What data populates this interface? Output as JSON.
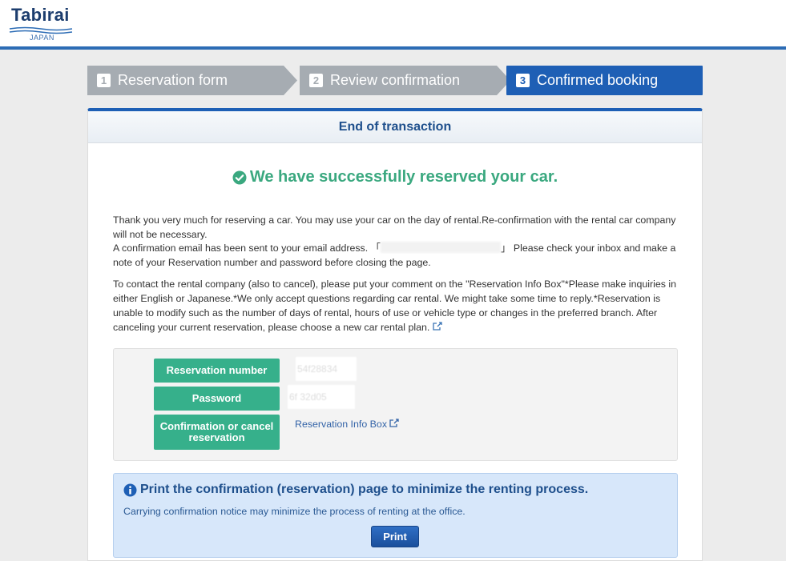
{
  "header": {
    "logo_text": "Tabirai",
    "logo_sub": "JAPAN"
  },
  "steps": [
    {
      "num": "1",
      "label": "Reservation form"
    },
    {
      "num": "2",
      "label": "Review confirmation"
    },
    {
      "num": "3",
      "label": "Confirmed booking"
    }
  ],
  "card": {
    "title": "End of transaction",
    "success": "We have successfully reserved your car.",
    "p1": "Thank you very much for reserving a car. You may use your car on the day of rental.Re-confirmation with the rental car company will not be necessary.",
    "p2_before": "A confirmation email has been sent to your email address. 「",
    "p2_after": "」 Please check your inbox and make a note of your Reservation number and password before closing the page.",
    "p3": "To contact the rental company (also to cancel), please put your comment on the \"Reservation Info Box\"*Please make inquiries in either English or Japanese.*We only accept questions regarding car rental. We might take some time to reply.*Reservation is unable to modify such as the number of days of rental, hours of use or vehicle type or changes in the preferred branch. After canceling your current reservation, please choose a new car rental plan."
  },
  "info": {
    "reservation_number_label": "Reservation number",
    "reservation_number_value": "54f28834",
    "password_label": "Password",
    "password_value": "6f 32d05",
    "confirm_cancel_label": "Confirmation or cancel reservation",
    "info_box_link": "Reservation Info Box"
  },
  "print": {
    "title": "Print the confirmation (reservation) page to minimize the renting process.",
    "note": "Carrying confirmation notice may minimize the process of renting at the office.",
    "button": "Print"
  },
  "colors": {
    "accent": "#1e5fb5",
    "success": "#3aa87f",
    "green_button": "#36b08b",
    "inactive_step": "#a6acb2"
  },
  "icons": {
    "success": "check-circle-icon",
    "external": "external-link-icon",
    "info": "info-circle-icon"
  }
}
